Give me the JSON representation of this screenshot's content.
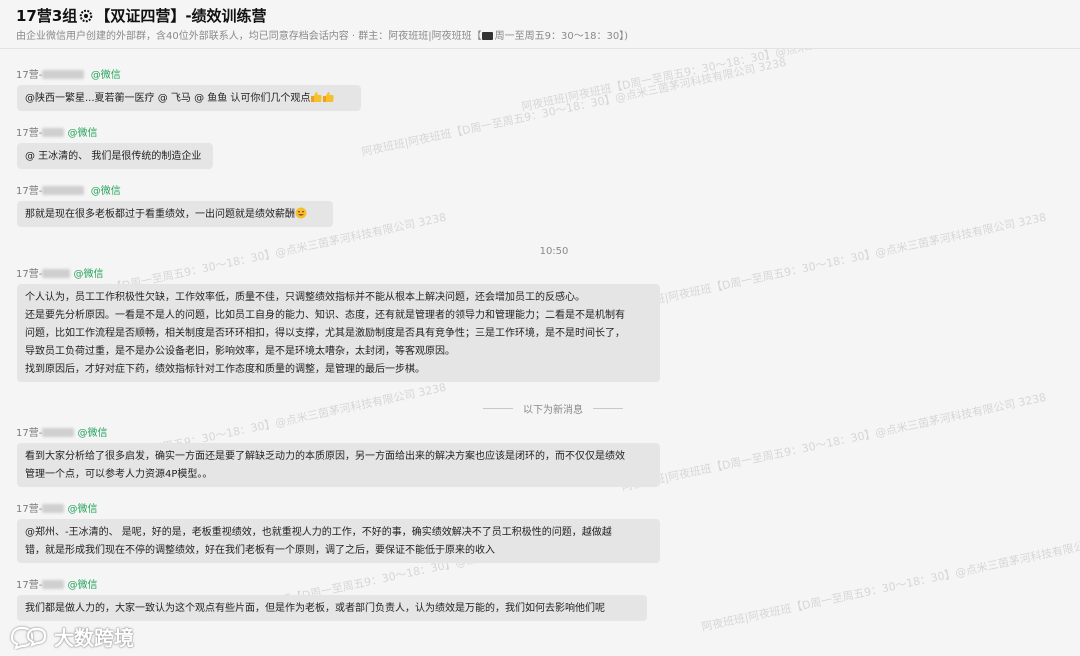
{
  "header": {
    "title_a": "17营3组",
    "title_b": "【双证四营】-绩效训练营",
    "subtitle_a": "由企业微信用户创建的外部群，含40位外部联系人，均已同意存档会话内容 · 群主：阿夜班班|阿夜班班【",
    "subtitle_b": "周一至周五9：30～18：30】)"
  },
  "messages": [
    {
      "prefix": "17营-",
      "src": "@微信",
      "lines": [
        "@陕西一繁星...夏若蘅一医疗 @ 飞马 @ 鱼鱼 认可你们几个观点"
      ]
    },
    {
      "prefix": "17营-",
      "src": "@微信",
      "lines": [
        "@ 王冰清的、 我们是很传统的制造企业"
      ]
    },
    {
      "prefix": "17营-",
      "src": "@微信",
      "lines": [
        "那就是现在很多老板都过于看重绩效，一出问题就是绩效薪酬"
      ]
    },
    {
      "prefix": "17营-",
      "src": "@微信",
      "lines": [
        "个人认为，员工工作积极性欠缺，工作效率低，质量不佳，只调整绩效指标并不能从根本上解决问题，还会增加员工的反感心。",
        "还是要先分析原因。一看是不是人的问题，比如员工自身的能力、知识、态度，还有就是管理者的领导力和管理能力；二看是不是机制有",
        "问题，比如工作流程是否顺畅，相关制度是否环环相扣，得以支撑，尤其是激励制度是否具有竞争性；三是工作环境，是不是时间长了，",
        "导致员工负荷过重，是不是办公设备老旧，影响效率，是不是环境太嘈杂，太封闭，等客观原因。",
        "找到原因后，才好对症下药，绩效指标针对工作态度和质量的调整，是管理的最后一步棋。"
      ]
    },
    {
      "prefix": "17营-",
      "src": "@微信",
      "lines": [
        "看到大家分析给了很多启发，确实一方面还是要了解缺乏动力的本质原因，另一方面给出来的解决方案也应该是闭环的，而不仅仅是绩效",
        "管理一个点，可以参考人力资源4P模型。。"
      ]
    },
    {
      "prefix": "17营-",
      "src": "@微信",
      "lines": [
        "@郑州、-王冰清的、 是呢，好的是，老板重视绩效，也就重视人力的工作，不好的事，确实绩效解决不了员工积极性的问题，越做越",
        "错，就是形成我们现在不停的调整绩效，好在我们老板有一个原则，调了之后，要保证不能低于原来的收入"
      ]
    },
    {
      "prefix": "17营-",
      "src": "@微信",
      "lines": [
        "我们都是做人力的，大家一致认为这个观点有些片面，但是作为老板，或者部门负责人，认为绩效是万能的，我们如何去影响他们呢"
      ]
    }
  ],
  "time": "10:50",
  "divider": "以下为新消息",
  "watermark": "阿夜班班|阿夜班班【D周一至周五9：30～18：30】@点米三茵茅河科技有限公司 3238",
  "logo": "大数跨境"
}
